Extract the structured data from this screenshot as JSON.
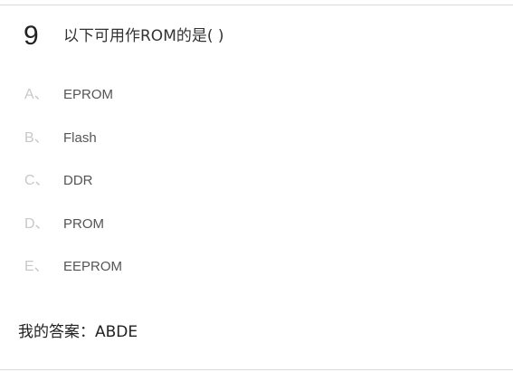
{
  "question": {
    "number": "9",
    "text": "以下可用作ROM的是( )"
  },
  "options": [
    {
      "letter": "A、",
      "text": "EPROM"
    },
    {
      "letter": "B、",
      "text": "Flash"
    },
    {
      "letter": "C、",
      "text": "DDR"
    },
    {
      "letter": "D、",
      "text": "PROM"
    },
    {
      "letter": "E、",
      "text": "EEPROM"
    }
  ],
  "answer": {
    "label": "我的答案：",
    "value": "ABDE"
  },
  "colors": {
    "divider": "#d9d9d9",
    "option_letter": "#c8c8c8",
    "option_text": "#555555",
    "primary_text": "#222222"
  }
}
